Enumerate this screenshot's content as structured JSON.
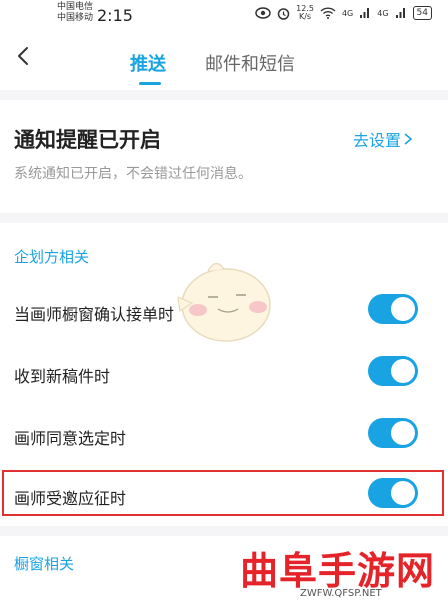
{
  "status_bar": {
    "carrier_1": "中国电信",
    "carrier_2": "中国移动",
    "time": "2:15",
    "speed_value": "12.5",
    "speed_unit": "K/s",
    "network_1": "4G",
    "network_2": "4G",
    "battery": "54"
  },
  "header": {
    "tab_push": "推送",
    "tab_mail_sms": "邮件和短信"
  },
  "notification": {
    "title": "通知提醒已开启",
    "goto_settings": "去设置",
    "description": "系统通知已开启，不会错过任何消息。"
  },
  "section_client": {
    "label": "企划方相关"
  },
  "toggles": [
    {
      "label": "当画师橱窗确认接单时",
      "on": true
    },
    {
      "label": "收到新稿件时",
      "on": true
    },
    {
      "label": "画师同意选定时",
      "on": true
    },
    {
      "label": "画师受邀应征时",
      "on": true
    }
  ],
  "section_window": {
    "label": "橱窗相关"
  },
  "watermark": {
    "main": "曲阜手游网",
    "sub": "ZWFW.QFSP.NET"
  },
  "colors": {
    "accent": "#1aa3e3",
    "highlight_border": "#e03030",
    "watermark": "#e5242a"
  }
}
